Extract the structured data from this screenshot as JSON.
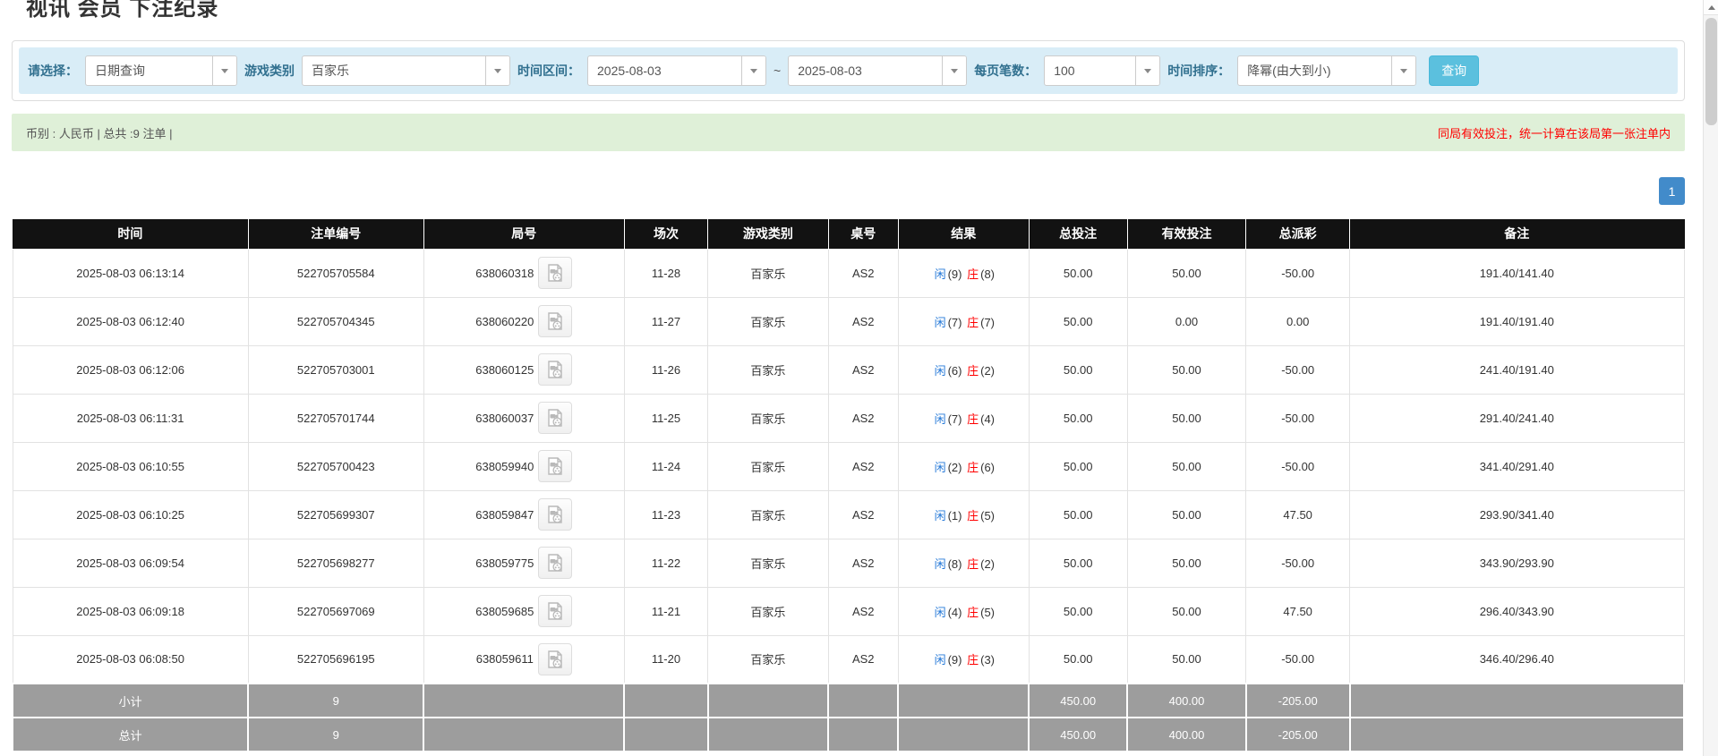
{
  "page": {
    "title": "视讯 会员 下注纪录"
  },
  "filters": {
    "select_label": "请选择：",
    "select_value": "日期查询",
    "game_type_label": "游戏类别",
    "game_type_value": "百家乐",
    "time_range_label": "时间区间：",
    "date_from": "2025-08-03",
    "date_separator": "~",
    "date_to": "2025-08-03",
    "page_size_label": "每页笔数：",
    "page_size_value": "100",
    "sort_label": "时间排序：",
    "sort_value": "降幂(由大到小)",
    "query_button": "查询"
  },
  "summary_bar": {
    "left_text": "币别 : 人民币 | 总共 :9 注单 |",
    "right_text": "同局有效投注，统一计算在该局第一张注单内"
  },
  "pagination": {
    "current_page": "1"
  },
  "table": {
    "headers": [
      "时间",
      "注单编号",
      "局号",
      "场次",
      "游戏类别",
      "桌号",
      "结果",
      "总投注",
      "有效投注",
      "总派彩",
      "备注"
    ],
    "rows": [
      {
        "time": "2025-08-03 06:13:14",
        "bet_id": "522705705584",
        "round": "638060318",
        "session": "11-28",
        "game": "百家乐",
        "table_no": "AS2",
        "result": {
          "player": "闲",
          "player_pts": "(9)",
          "banker": "庄",
          "banker_pts": "(8)"
        },
        "total_bet": "50.00",
        "valid_bet": "50.00",
        "payout": "-50.00",
        "remark": "191.40/141.40"
      },
      {
        "time": "2025-08-03 06:12:40",
        "bet_id": "522705704345",
        "round": "638060220",
        "session": "11-27",
        "game": "百家乐",
        "table_no": "AS2",
        "result": {
          "player": "闲",
          "player_pts": "(7)",
          "banker": "庄",
          "banker_pts": "(7)"
        },
        "total_bet": "50.00",
        "valid_bet": "0.00",
        "payout": "0.00",
        "remark": "191.40/191.40"
      },
      {
        "time": "2025-08-03 06:12:06",
        "bet_id": "522705703001",
        "round": "638060125",
        "session": "11-26",
        "game": "百家乐",
        "table_no": "AS2",
        "result": {
          "player": "闲",
          "player_pts": "(6)",
          "banker": "庄",
          "banker_pts": "(2)"
        },
        "total_bet": "50.00",
        "valid_bet": "50.00",
        "payout": "-50.00",
        "remark": "241.40/191.40"
      },
      {
        "time": "2025-08-03 06:11:31",
        "bet_id": "522705701744",
        "round": "638060037",
        "session": "11-25",
        "game": "百家乐",
        "table_no": "AS2",
        "result": {
          "player": "闲",
          "player_pts": "(7)",
          "banker": "庄",
          "banker_pts": "(4)"
        },
        "total_bet": "50.00",
        "valid_bet": "50.00",
        "payout": "-50.00",
        "remark": "291.40/241.40"
      },
      {
        "time": "2025-08-03 06:10:55",
        "bet_id": "522705700423",
        "round": "638059940",
        "session": "11-24",
        "game": "百家乐",
        "table_no": "AS2",
        "result": {
          "player": "闲",
          "player_pts": "(2)",
          "banker": "庄",
          "banker_pts": "(6)"
        },
        "total_bet": "50.00",
        "valid_bet": "50.00",
        "payout": "-50.00",
        "remark": "341.40/291.40"
      },
      {
        "time": "2025-08-03 06:10:25",
        "bet_id": "522705699307",
        "round": "638059847",
        "session": "11-23",
        "game": "百家乐",
        "table_no": "AS2",
        "result": {
          "player": "闲",
          "player_pts": "(1)",
          "banker": "庄",
          "banker_pts": "(5)"
        },
        "total_bet": "50.00",
        "valid_bet": "50.00",
        "payout": "47.50",
        "remark": "293.90/341.40"
      },
      {
        "time": "2025-08-03 06:09:54",
        "bet_id": "522705698277",
        "round": "638059775",
        "session": "11-22",
        "game": "百家乐",
        "table_no": "AS2",
        "result": {
          "player": "闲",
          "player_pts": "(8)",
          "banker": "庄",
          "banker_pts": "(2)"
        },
        "total_bet": "50.00",
        "valid_bet": "50.00",
        "payout": "-50.00",
        "remark": "343.90/293.90"
      },
      {
        "time": "2025-08-03 06:09:18",
        "bet_id": "522705697069",
        "round": "638059685",
        "session": "11-21",
        "game": "百家乐",
        "table_no": "AS2",
        "result": {
          "player": "闲",
          "player_pts": "(4)",
          "banker": "庄",
          "banker_pts": "(5)"
        },
        "total_bet": "50.00",
        "valid_bet": "50.00",
        "payout": "47.50",
        "remark": "296.40/343.90"
      },
      {
        "time": "2025-08-03 06:08:50",
        "bet_id": "522705696195",
        "round": "638059611",
        "session": "11-20",
        "game": "百家乐",
        "table_no": "AS2",
        "result": {
          "player": "闲",
          "player_pts": "(9)",
          "banker": "庄",
          "banker_pts": "(3)"
        },
        "total_bet": "50.00",
        "valid_bet": "50.00",
        "payout": "-50.00",
        "remark": "346.40/296.40"
      }
    ],
    "subtotal": {
      "label": "小计",
      "count": "9",
      "total_bet": "450.00",
      "valid_bet": "400.00",
      "payout": "-205.00"
    },
    "total": {
      "label": "总计",
      "count": "9",
      "total_bet": "450.00",
      "valid_bet": "400.00",
      "payout": "-205.00"
    }
  },
  "colors": {
    "accent_blue": "#2579d8",
    "negative_red": "#ff0000",
    "filter_bg": "#d9edf7",
    "alert_bg": "#dff0d8",
    "header_bg": "#121212",
    "summary_bg": "#9d9d9d",
    "query_button_bg": "#5bc0de",
    "pager_bg": "#428bca"
  }
}
